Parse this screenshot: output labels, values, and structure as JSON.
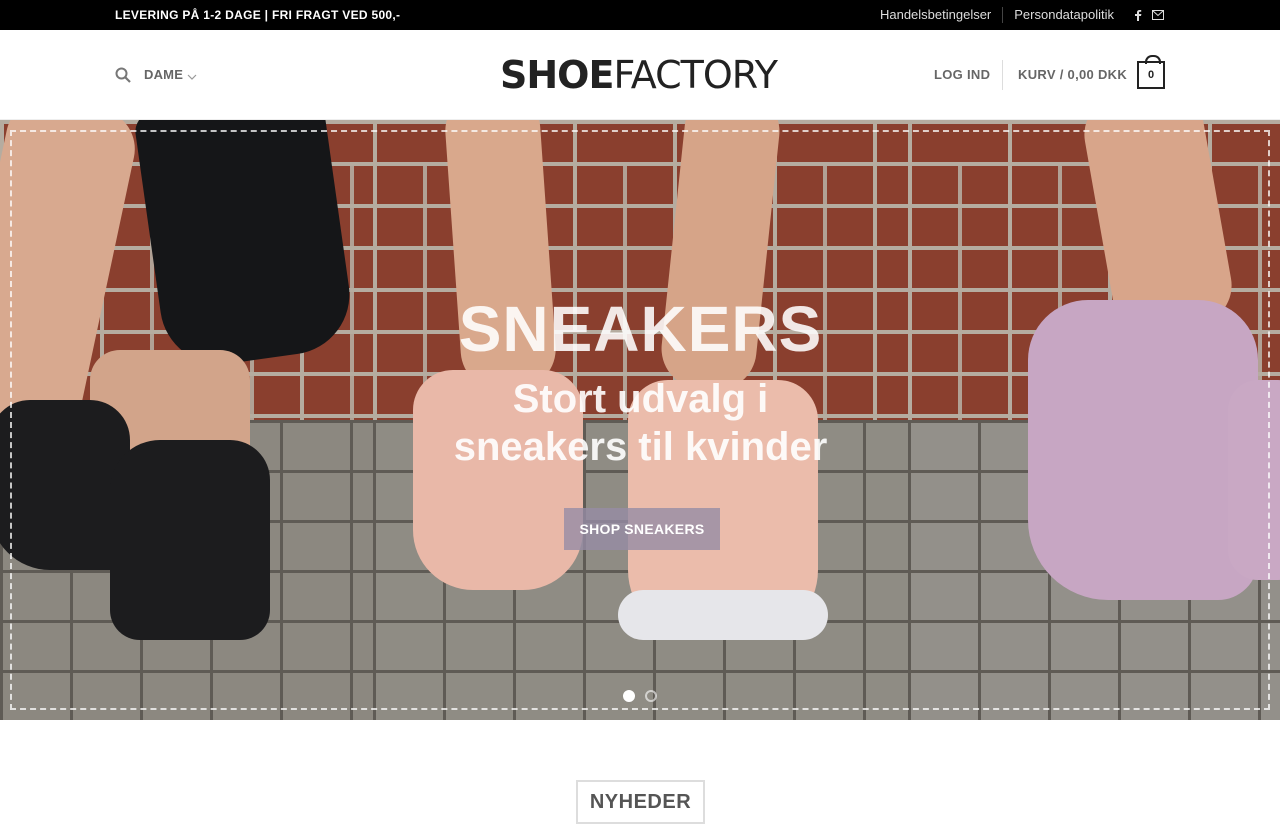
{
  "topbar": {
    "promo": "LEVERING PÅ 1-2 DAGE | FRI FRAGT VED 500,-",
    "links": [
      "Handelsbetingelser",
      "Persondatapolitik"
    ],
    "icons": [
      "facebook-icon",
      "mail-icon"
    ]
  },
  "header": {
    "nav_label": "DAME",
    "logo_bold": "SHOE",
    "logo_light": "FACTORY",
    "login_label": "LOG IND",
    "cart_label": "KURV / 0,00 DKK",
    "cart_count": "0"
  },
  "hero": {
    "title": "SNEAKERS",
    "subtitle_line1": "Stort udvalg i",
    "subtitle_line2": "sneakers til kvinder",
    "button_label": "SHOP SNEAKERS",
    "slide_count": 2,
    "active_slide": 1
  },
  "section": {
    "title": "NYHEDER"
  },
  "colors": {
    "topbar_bg": "#000000",
    "brick": "#8a3f2e",
    "pavement": "#8c8880",
    "shoe_pink": "#e9b8a8",
    "shoe_lilac": "#c7a6c3",
    "shoe_black": "#1c1c1e"
  }
}
